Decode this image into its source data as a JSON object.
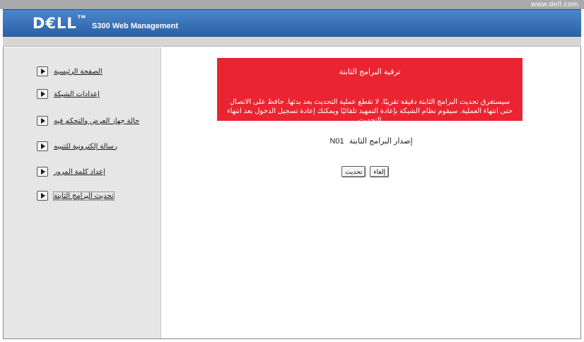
{
  "top_bar": {
    "url": "www.dell.com"
  },
  "header": {
    "logo": "D€LL",
    "logo_tm": "TM",
    "product": "S300 Web Management"
  },
  "sidebar": {
    "items": [
      {
        "label": "الصفحة الرئيسية",
        "icon": "play-icon"
      },
      {
        "label": "إعدادات الشبكة",
        "icon": "play-icon"
      },
      {
        "label": "حالة جهاز العرض والتحكم فيه",
        "icon": "play-icon"
      },
      {
        "label": "رسالة إلكترونية للتنبيه",
        "icon": "play-icon"
      },
      {
        "label": "إعداد كلمة المرور",
        "icon": "play-icon"
      },
      {
        "label": "تحديث البرامج الثابتة",
        "icon": "play-icon",
        "active": true
      }
    ]
  },
  "alert": {
    "title": "ترقية البرامج الثابتة",
    "body": "سيستغرق تحديث البرامج الثابتة دقيقة تقريبًا. لا تقطع عملية التحديث بعد بدئها. حافظ على الاتصال حتى انتهاء العملية. سيقوم نظام الشبكة بإعادة التمهيد تلقائيًا ويمكنك إعادة تسجيل الدخول بعد انتهاء التحديث",
    "color": "#ea2431"
  },
  "firmware": {
    "label": "إصدار البرامج الثابتة",
    "value": "N01"
  },
  "buttons": {
    "update": "تحديث",
    "cancel": "إلغاء"
  }
}
